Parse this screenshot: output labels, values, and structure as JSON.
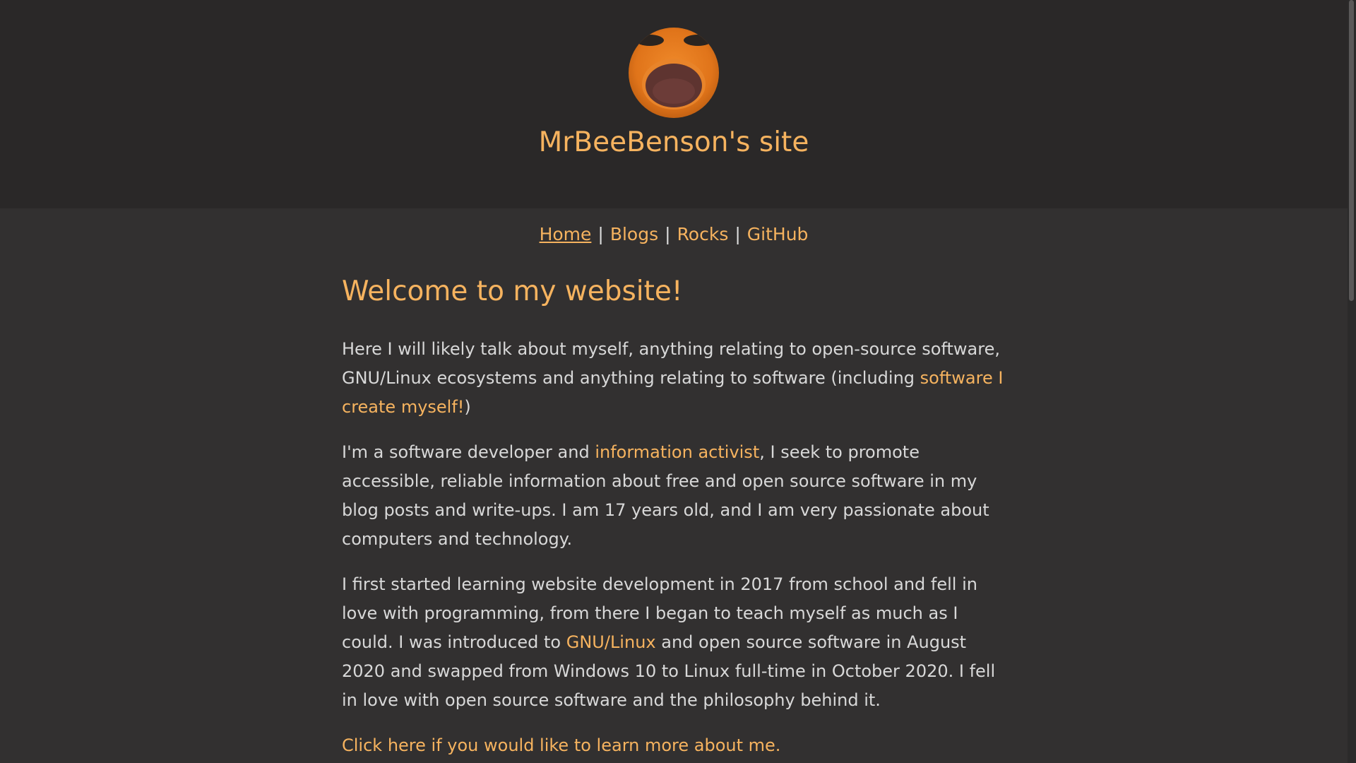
{
  "header": {
    "avatar_icon": "bee-face-avatar-icon",
    "title": "MrBeeBenson's site"
  },
  "nav": {
    "items": [
      {
        "label": "Home",
        "current": true
      },
      {
        "label": "Blogs"
      },
      {
        "label": "Rocks"
      },
      {
        "label": "GitHub"
      }
    ],
    "separator": "|"
  },
  "content": {
    "heading": "Welcome to my website!",
    "p1": {
      "t1": "Here I will likely talk about myself, anything relating to open-source software, GNU/Linux ecosystems and anything relating to software (including ",
      "link": "software I create myself!",
      "t2": ")"
    },
    "p2": {
      "t1": "I'm a software developer and ",
      "link": "information activist",
      "t2": ", I seek to promote accessible, reliable information about free and open source software in my blog posts and write-ups. I am 17 years old, and I am very passionate about computers and technology."
    },
    "p3": {
      "t1": "I first started learning website development in 2017 from school and fell in love with programming, from there I began to teach myself as much as I could. I was introduced to ",
      "link": "GNU/Linux",
      "t2": " and open source software in August 2020 and swapped from Windows 10 to Linux full-time in October 2020. I fell in love with open source software and the philosophy behind it."
    },
    "p4": {
      "link": "Click here if you would like to learn more about me."
    }
  },
  "colors": {
    "accent": "#f6b35f",
    "text": "#d8d8d8",
    "header_bg": "#2a2828",
    "page_bg": "#323030"
  }
}
